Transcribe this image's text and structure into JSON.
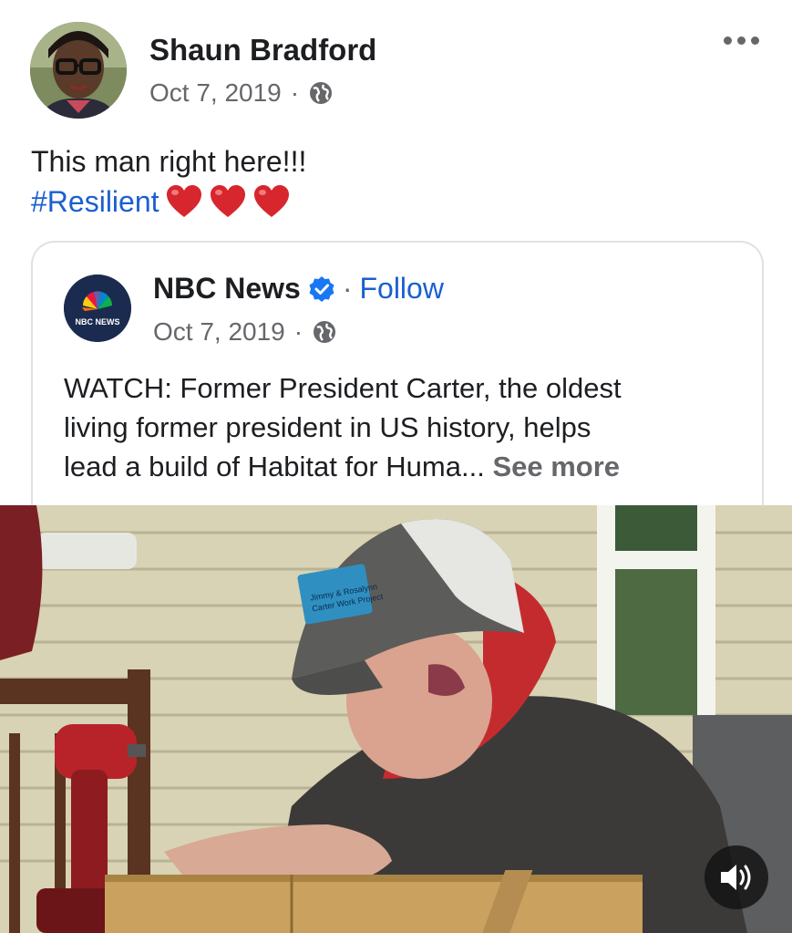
{
  "post": {
    "author_name": "Shaun Bradford",
    "date": "Oct 7, 2019",
    "separator": "·",
    "privacy_icon": "globe-icon",
    "more_icon": "more-horizontal-icon",
    "text_line1": "This man right here!!!",
    "hashtag": "#Resilient",
    "emoji": [
      "red-heart",
      "red-heart",
      "red-heart"
    ]
  },
  "shared": {
    "page_name": "NBC News",
    "verified_icon": "verified-badge-icon",
    "follow_separator": "·",
    "follow_label": "Follow",
    "date": "Oct 7, 2019",
    "separator": "·",
    "privacy_icon": "globe-icon",
    "logo_text": "NBC NEWS",
    "caption_line1": "WATCH: Former President Carter, the oldest",
    "caption_line2": "living former president in US history, helps",
    "caption_line3": "lead a build of Habitat for Huma...",
    "see_more": "See more"
  },
  "video": {
    "cap_patch_line1": "Jimmy & Rosalynn",
    "cap_patch_line2": "Carter Work Project",
    "sound_icon": "speaker-volume-icon"
  },
  "colors": {
    "link_blue": "#1b5fd1",
    "text_primary": "#1c1e21",
    "text_secondary": "#65676b",
    "verified_blue": "#1877f2",
    "heart_red": "#d7262d"
  }
}
